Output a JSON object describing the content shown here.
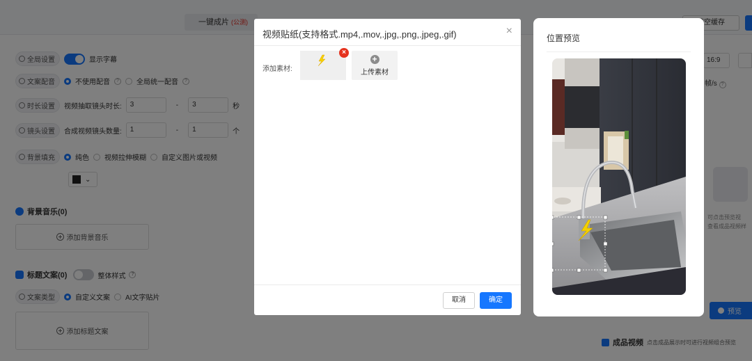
{
  "background": {
    "top_tab": {
      "label": "一键成片",
      "badge": "(公测)"
    },
    "clear_cache_button": "清空缓存",
    "left_panel": {
      "global_setting": {
        "label": "全局设置",
        "toggle_label": "显示字幕"
      },
      "dubbing": {
        "label": "文案配音",
        "options": [
          "不使用配音",
          "全局统一配音"
        ]
      },
      "duration": {
        "label": "时长设置",
        "text": "视频抽取镜头时长:",
        "min": "3",
        "max": "3",
        "unit": "秒"
      },
      "shots": {
        "label": "镜头设置",
        "text": "合成视频镜头数量:",
        "min": "1",
        "max": "1",
        "unit": "个"
      },
      "bg_fill": {
        "label": "背景填充",
        "options": [
          "纯色",
          "视频拉伸模糊",
          "自定义图片或视频"
        ]
      },
      "bg_music": {
        "title": "背景音乐(0)",
        "add_label": "添加背景音乐"
      },
      "title_copy": {
        "title": "标题文案(0)",
        "style_label": "整体样式"
      },
      "copy_type": {
        "label": "文案类型",
        "options": [
          "自定义文案",
          "AI文字贴片"
        ]
      },
      "add_title": "添加标题文案"
    },
    "right_panel": {
      "ratio": "16:9",
      "fps_unit": "帧/s",
      "placeholder_line1": "可点击预览视",
      "placeholder_line2": "查看成品视频样",
      "preview_button": "预览",
      "product_title": "成品视频",
      "product_hint": "点击成品展示时可进行视频组合预览"
    }
  },
  "modal": {
    "title": "视频贴纸(支持格式.mp4,.mov,.jpg,.png,.jpeg,.gif)",
    "close_icon": "close-icon",
    "add_label": "添加素材:",
    "upload_label": "上传素材",
    "cancel_label": "取消",
    "ok_label": "确定"
  },
  "position_preview": {
    "title": "位置预览"
  }
}
